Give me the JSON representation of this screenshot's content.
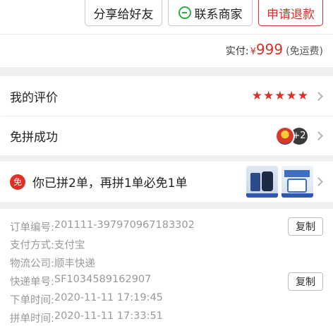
{
  "actions": {
    "share_label": "分享给好友",
    "contact_label": "联系商家",
    "refund_label": "申请退款"
  },
  "payment": {
    "label": "实付:",
    "currency": "¥",
    "amount": "999",
    "note": "(免运费)"
  },
  "review": {
    "label": "我的评价",
    "stars": "★★★★★",
    "rating": 5
  },
  "group": {
    "label": "免拼成功",
    "extra_count": "+2"
  },
  "promo": {
    "icon_text": "免",
    "text": "你已拼2单，再拼1单必免1单"
  },
  "order": {
    "copy_label": "复制",
    "lines": [
      {
        "key": "订单编号:",
        "value": "201111-397970967183302"
      },
      {
        "key": "支付方式:",
        "value": "支付宝"
      },
      {
        "key": "物流公司:",
        "value": "顺丰快递"
      },
      {
        "key": "快递单号:",
        "value": "SF1034589162907"
      },
      {
        "key": "下单时间:",
        "value": "2020-11-11 17:19:45"
      },
      {
        "key": "拼单时间:",
        "value": "2020-11-11 17:33:51"
      }
    ]
  },
  "colors": {
    "accent": "#e02e24",
    "chat_green": "#2aae43",
    "background": "#efefef",
    "muted_text": "#999999"
  }
}
